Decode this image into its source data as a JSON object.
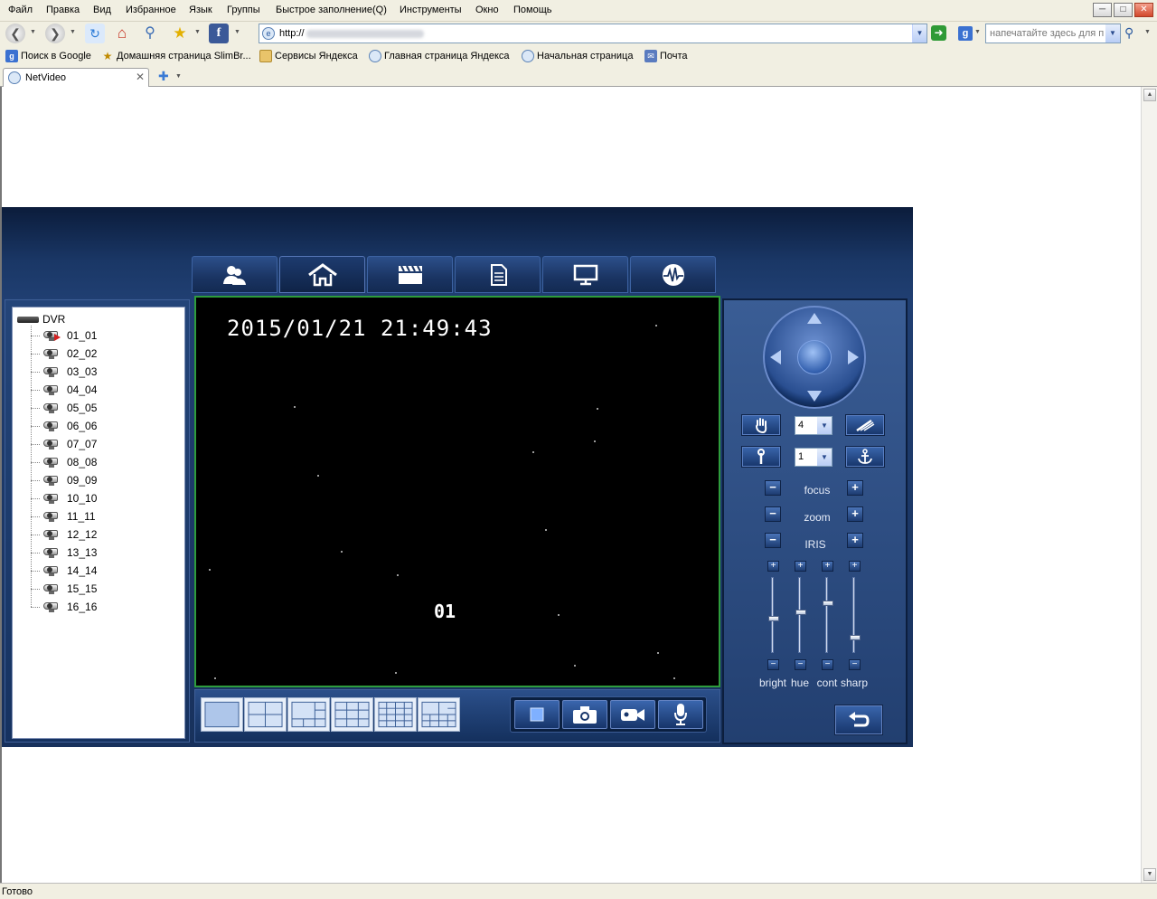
{
  "browser": {
    "menu": [
      "Файл",
      "Правка",
      "Вид",
      "Избранное",
      "Язык",
      "Группы",
      "Быстрое заполнение(Q)",
      "Инструменты",
      "Окно",
      "Помощь"
    ],
    "address": {
      "url": "http://"
    },
    "search": {
      "placeholder": "напечатайте здесь для п"
    },
    "bookmarks": [
      "Поиск в Google",
      "Домашняя страница SlimBr...",
      "Сервисы Яндекса",
      "Главная страница Яндекса",
      "Начальная страница",
      "Почта"
    ],
    "tab": {
      "title": "NetVideo"
    },
    "status": "Готово"
  },
  "app": {
    "tree": {
      "root": "DVR",
      "channels": [
        "01_01",
        "02_02",
        "03_03",
        "04_04",
        "05_05",
        "06_06",
        "07_07",
        "08_08",
        "09_09",
        "10_10",
        "11_11",
        "12_12",
        "13_13",
        "14_14",
        "15_15",
        "16_16"
      ]
    },
    "video": {
      "timestamp": "2015/01/21 21:49:43",
      "channel": "01"
    },
    "ptz": {
      "speed": "4",
      "preset": "1",
      "focus": "focus",
      "zoom": "zoom",
      "iris": "IRIS",
      "sliders": [
        {
          "label": "bright",
          "level": 0.55
        },
        {
          "label": "hue",
          "level": 0.47
        },
        {
          "label": "cont",
          "level": 0.34
        },
        {
          "label": "sharp",
          "level": 0.8
        }
      ]
    },
    "colors": {
      "accent": "#1a3766",
      "video_border": "#2e9c3c"
    }
  }
}
